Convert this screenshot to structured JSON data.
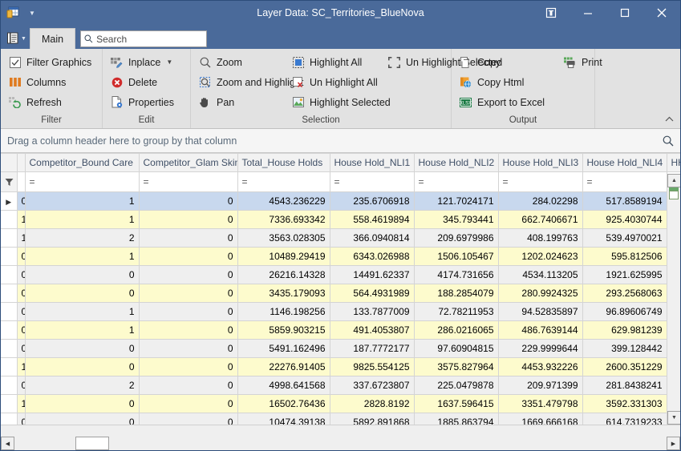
{
  "window": {
    "title": "Layer Data: SC_Territories_BlueNova",
    "app_icon": "grid-table-icon",
    "caret_icon": "chevron-down-icon",
    "buttons": [
      {
        "name": "restore-down-pin-button",
        "icon": "pin-window-icon",
        "label": ""
      },
      {
        "name": "minimize-button",
        "icon": "minimize-icon",
        "label": ""
      },
      {
        "name": "maximize-button",
        "icon": "maximize-icon",
        "label": ""
      },
      {
        "name": "close-button",
        "icon": "close-icon",
        "label": ""
      }
    ]
  },
  "tabstrip": {
    "quick_access_icon": "menu-list-icon",
    "quick_access_caret": "chevron-down-icon",
    "tabs": [
      {
        "label": "Main",
        "active": true
      }
    ],
    "search": {
      "placeholder": "Search",
      "value": "",
      "icon": "search-icon"
    }
  },
  "ribbon": {
    "collapse_icon": "chevron-up-icon",
    "groups": [
      {
        "label": "Filter",
        "items": [
          {
            "label": "Filter Graphics",
            "icon": "checkbox-checked-icon",
            "caret": false
          },
          {
            "label": "Columns",
            "icon": "columns-icon",
            "caret": false
          },
          {
            "label": "Refresh",
            "icon": "refresh-icon",
            "caret": false
          }
        ]
      },
      {
        "label": "Edit",
        "items": [
          {
            "label": "Inplace",
            "icon": "inplace-edit-icon",
            "caret": true
          },
          {
            "label": "Delete",
            "icon": "delete-icon",
            "caret": false
          },
          {
            "label": "Properties",
            "icon": "properties-icon",
            "caret": false
          }
        ]
      },
      {
        "label": "Selection",
        "items": [
          {
            "label": "Zoom",
            "icon": "zoom-icon",
            "caret": false
          },
          {
            "label": "Zoom and Highlight",
            "icon": "zoom-highlight-icon",
            "caret": false
          },
          {
            "label": "Pan",
            "icon": "pan-hand-icon",
            "caret": false
          },
          {
            "label": "Highlight All",
            "icon": "highlight-all-icon",
            "caret": false
          },
          {
            "label": "Un Highlight All",
            "icon": "un-highlight-all-icon",
            "caret": false
          },
          {
            "label": "Highlight Selected",
            "icon": "highlight-selected-icon",
            "caret": false
          },
          {
            "label": "Un Highlight Selected",
            "icon": "un-highlight-selected-icon",
            "caret": false
          }
        ]
      },
      {
        "label": "Output",
        "items": [
          {
            "label": "Copy",
            "icon": "copy-icon",
            "caret": false
          },
          {
            "label": "Copy Html",
            "icon": "copy-html-icon",
            "caret": false
          },
          {
            "label": "Export to Excel",
            "icon": "export-excel-icon",
            "caret": false
          },
          {
            "label": "Print",
            "icon": "print-icon",
            "caret": false
          }
        ]
      }
    ]
  },
  "group_panel": {
    "text": "Drag a column header here to group by that column",
    "find_icon": "search-icon"
  },
  "grid": {
    "filter_icon": "filter-funnel-icon",
    "row_indicator_icon": "current-row-arrow-icon",
    "filter_operator": "=",
    "columns": [
      "Competitor_Bound Care",
      "Competitor_Glam Skin",
      "Total_House Holds",
      "House Hold_NLI1",
      "House Hold_NLI2",
      "House Hold_NLI3",
      "House Hold_NLI4"
    ],
    "clipped_left_column_values": [
      "0",
      "1",
      "1",
      "0",
      "0",
      "0",
      "0",
      "0",
      "0",
      "1",
      "0",
      "1",
      "0"
    ],
    "clipped_right_column_header": "HH",
    "rows": [
      {
        "state": "selected",
        "cells": [
          "1",
          "0",
          "4543.236229",
          "235.6706918",
          "121.7024171",
          "284.02298",
          "517.8589194"
        ]
      },
      {
        "state": "alt",
        "cells": [
          "1",
          "0",
          "7336.693342",
          "558.4619894",
          "345.793441",
          "662.7406671",
          "925.4030744"
        ]
      },
      {
        "state": "norm",
        "cells": [
          "2",
          "0",
          "3563.028305",
          "366.0940814",
          "209.6979986",
          "408.199763",
          "539.4970021"
        ]
      },
      {
        "state": "alt",
        "cells": [
          "1",
          "0",
          "10489.29419",
          "6343.026988",
          "1506.105467",
          "1202.024623",
          "595.812506"
        ]
      },
      {
        "state": "norm",
        "cells": [
          "0",
          "0",
          "26216.14328",
          "14491.62337",
          "4174.731656",
          "4534.113205",
          "1921.625995"
        ]
      },
      {
        "state": "alt",
        "cells": [
          "0",
          "0",
          "3435.179093",
          "564.4931989",
          "188.2854079",
          "280.9924325",
          "293.2568063"
        ]
      },
      {
        "state": "norm",
        "cells": [
          "1",
          "0",
          "1146.198256",
          "133.7877009",
          "72.78211953",
          "94.52835897",
          "96.89606749"
        ]
      },
      {
        "state": "alt",
        "cells": [
          "1",
          "0",
          "5859.903215",
          "491.4053807",
          "286.0216065",
          "486.7639144",
          "629.981239"
        ]
      },
      {
        "state": "norm",
        "cells": [
          "0",
          "0",
          "5491.162496",
          "187.7772177",
          "97.60904815",
          "229.9999644",
          "399.128442"
        ]
      },
      {
        "state": "alt",
        "cells": [
          "0",
          "0",
          "22276.91405",
          "9825.554125",
          "3575.827964",
          "4453.932226",
          "2600.351229"
        ]
      },
      {
        "state": "norm",
        "cells": [
          "2",
          "0",
          "4998.641568",
          "337.6723807",
          "225.0479878",
          "209.971399",
          "281.8438241"
        ]
      },
      {
        "state": "alt",
        "cells": [
          "0",
          "0",
          "16502.76436",
          "2828.8192",
          "1637.596415",
          "3351.479798",
          "3592.331303"
        ]
      },
      {
        "state": "norm",
        "cells": [
          "0",
          "0",
          "10474.39138",
          "5892.891868",
          "1885.863794",
          "1669.666168",
          "614.7319233"
        ]
      }
    ]
  },
  "scrollbars": {
    "vertical": {
      "up_icon": "triangle-up-icon",
      "down_icon": "triangle-down-icon"
    },
    "horizontal": {
      "left_icon": "triangle-left-icon",
      "right_icon": "triangle-right-icon"
    }
  },
  "colors": {
    "titlebar": "#4a6a9a",
    "ribbon": "#e2e2e2",
    "selected_row": "#c8d8ee",
    "alt_row": "#fdfbcd",
    "norm_row": "#efefef",
    "header_text": "#3f4f66"
  }
}
